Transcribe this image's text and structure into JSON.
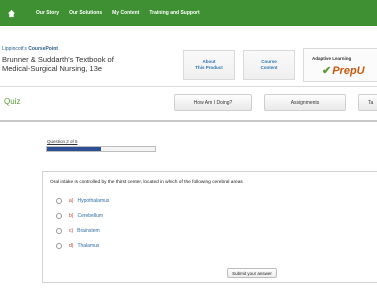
{
  "nav": {
    "home_icon": "home-icon",
    "items": [
      "Our Story",
      "Our Solutions",
      "My Content",
      "Training and Support"
    ]
  },
  "header": {
    "brand_prefix": "Lippincott's ",
    "brand_name": "CoursePoint",
    "book_title_line1": "Brunner & Suddarth's Textbook of",
    "book_title_line2": "Medical-Surgical Nursing, 13e",
    "about_line1": "About",
    "about_line2": "This Product",
    "course_line1": "Course",
    "course_line2": "Content",
    "adaptive_label": "Adaptive Learning",
    "prepu_logo_text": "PrepU"
  },
  "subbar": {
    "title": "Quiz",
    "how_label": "How Am I Doing?",
    "assignments_label": "Assignments",
    "cut_label": "Ta"
  },
  "quiz": {
    "progress_label": "Question 2 of 5",
    "progress_fraction": 0.5,
    "question": "Oral intake is controlled by the thirst center, located in which of the following cerebral areas",
    "options": [
      {
        "letter": "a)",
        "text": "Hypothalamus"
      },
      {
        "letter": "b)",
        "text": "Cerebellum"
      },
      {
        "letter": "c)",
        "text": "Brainstem"
      },
      {
        "letter": "d)",
        "text": "Thalamus"
      }
    ],
    "submit_label": "Submit your answer"
  },
  "colors": {
    "nav_green": "#3f8f33",
    "quiz_green": "#5a9a37",
    "progress_blue": "#2f4f94",
    "link_blue": "#2f6ea8",
    "letter_red": "#c0392b",
    "prepu_orange": "#c9580b"
  }
}
